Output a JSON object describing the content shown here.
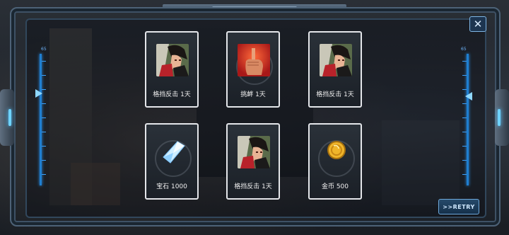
{
  "rewards": [
    {
      "label": "格挡反击 1天",
      "icon": "fighter-portrait-icon"
    },
    {
      "label": "挑衅 1天",
      "icon": "taunt-finger-icon"
    },
    {
      "label": "格挡反击 1天",
      "icon": "fighter-portrait-icon"
    },
    {
      "label": "宝石 1000",
      "icon": "gem-icon"
    },
    {
      "label": "格挡反击 1天",
      "icon": "fighter-portrait-icon"
    },
    {
      "label": "金币 500",
      "icon": "gold-coin-icon"
    }
  ],
  "scale": {
    "left_label": "65",
    "right_label": "65"
  },
  "retry_label": ">>RETRY",
  "close_label": "✕",
  "colors": {
    "accent": "#2b9bff",
    "card_border": "#e4e6ea",
    "frame": "#4d6277"
  }
}
